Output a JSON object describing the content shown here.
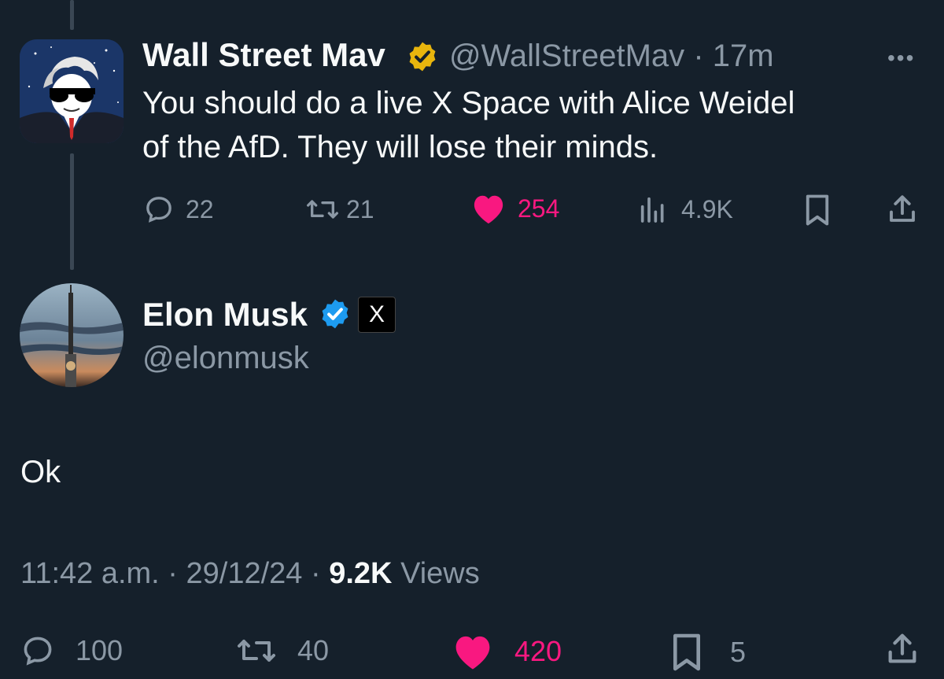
{
  "parent_tweet": {
    "author_name": "Wall Street Mav",
    "handle": "@WallStreetMav",
    "separator": "·",
    "time_ago": "17m",
    "text_line1": "You should do a live X Space with Alice Weidel",
    "text_line2": "of the AfD. They will lose their minds.",
    "replies": "22",
    "reposts": "21",
    "likes": "254",
    "views": "4.9K",
    "badge": "verified-gold",
    "colors": {
      "like": "#f91880",
      "badge": "#e8b50d"
    }
  },
  "main_tweet": {
    "author_name": "Elon Musk",
    "handle": "@elonmusk",
    "text": "Ok",
    "time": "11:42 a.m.",
    "dot1": "·",
    "date": "29/12/24",
    "dot2": "·",
    "views_count": "9.2K",
    "views_label": "Views",
    "replies": "100",
    "reposts": "40",
    "likes": "420",
    "bookmarks": "5",
    "badge": "verified-blue",
    "affiliation": "X",
    "colors": {
      "like": "#f91880",
      "badge": "#1d9bf0"
    }
  },
  "theme": {
    "background": "#15202b",
    "text": "#f7f9f9",
    "muted": "#8b98a5"
  }
}
